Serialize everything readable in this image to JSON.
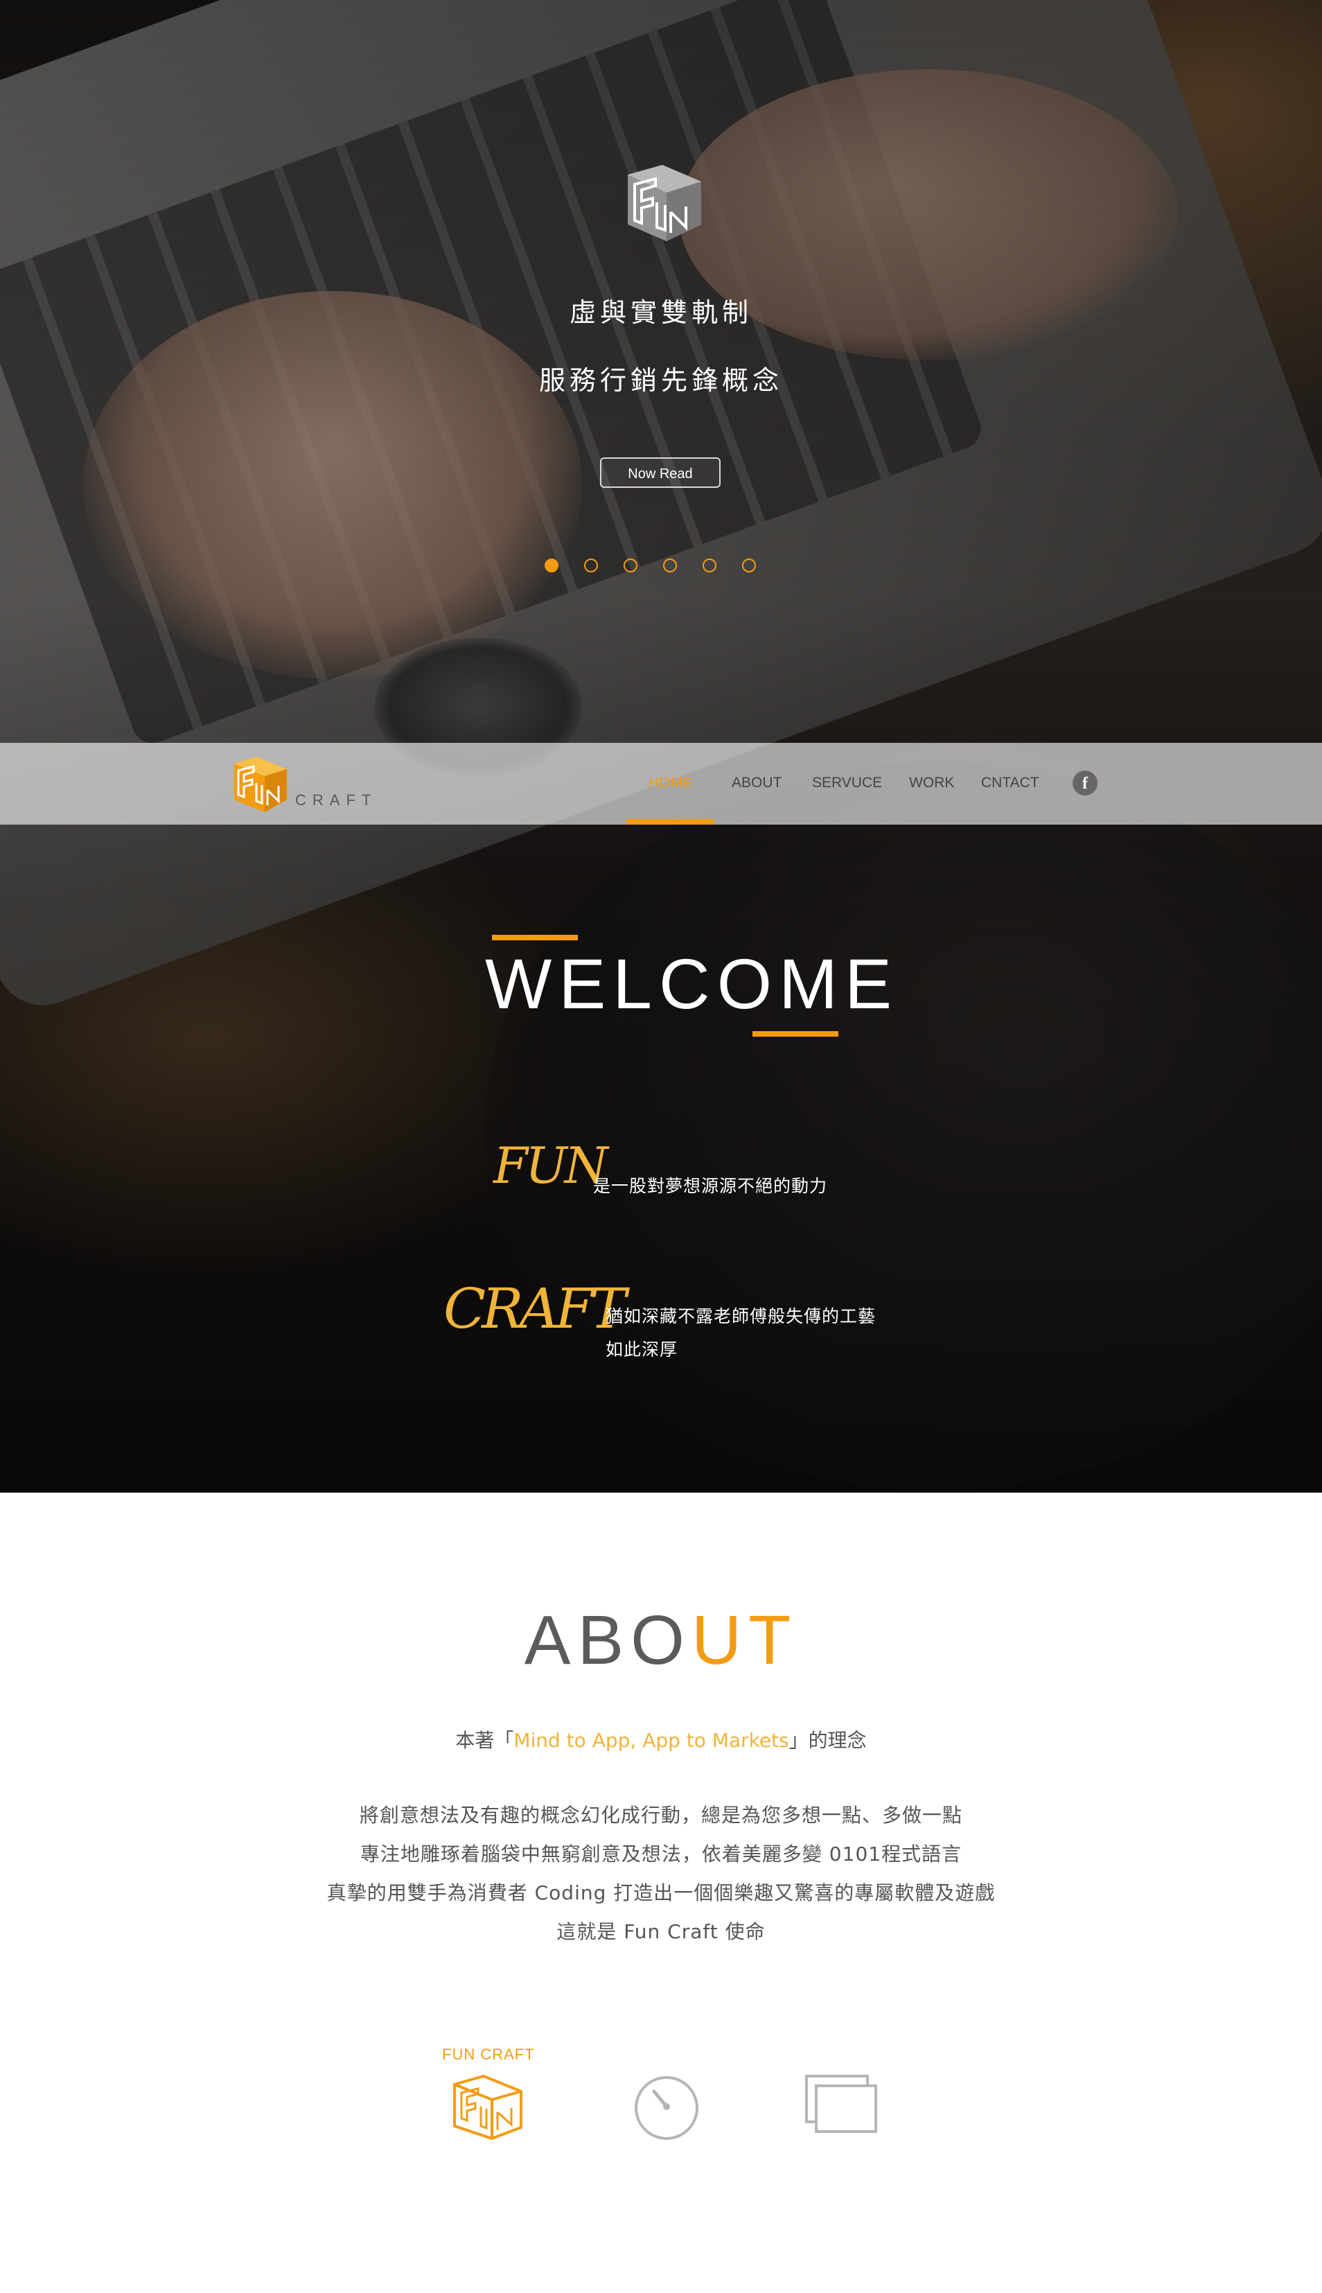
{
  "hero": {
    "line1": "虛與實雙軌制",
    "line2": "服務行銷先鋒概念",
    "button_label": "Now Read",
    "slides": [
      {
        "active": true
      },
      {
        "active": false
      },
      {
        "active": false
      },
      {
        "active": false
      },
      {
        "active": false
      },
      {
        "active": false
      }
    ]
  },
  "nav": {
    "brand_text": "CRAFT",
    "items": [
      {
        "label": "HOME",
        "active": true
      },
      {
        "label": "ABOUT",
        "active": false
      },
      {
        "label": "SERVUCE",
        "active": false
      },
      {
        "label": "WORK",
        "active": false
      },
      {
        "label": "CNTACT",
        "active": false
      }
    ],
    "social_icon": "facebook-icon",
    "social_glyph": "f"
  },
  "welcome": {
    "title": "WELCOME",
    "fun_script": "FUN",
    "fun_desc": "是一股對夢想源源不絕的動力",
    "craft_script": "CRAFT",
    "craft_desc_line1": "猶如深藏不露老師傅般失傳的工藝",
    "craft_desc_line2": "如此深厚"
  },
  "about": {
    "title_part1": "ABO",
    "title_part2": "UT",
    "motto_prefix": "本著「",
    "motto_highlight": "Mind to App, App to Markets",
    "motto_suffix": "」的理念",
    "paragraph": [
      "將創意想法及有趣的概念幻化成行動，總是為您多想一點、多做一點",
      "專注地雕琢着腦袋中無窮創意及想法，依着美麗多變 0101程式語言",
      "真摯的用雙手為消費者 Coding 打造出一個個樂趣又驚喜的專屬軟體及遊戲",
      "這就是 Fun Craft 使命"
    ],
    "icon_label": "FUN CRAFT",
    "icons": [
      "fun-craft-logo-icon",
      "timer-icon",
      "windows-icon"
    ]
  },
  "colors": {
    "accent": "#f39c12",
    "script": "#f0b43a",
    "text_gray": "#555555"
  }
}
